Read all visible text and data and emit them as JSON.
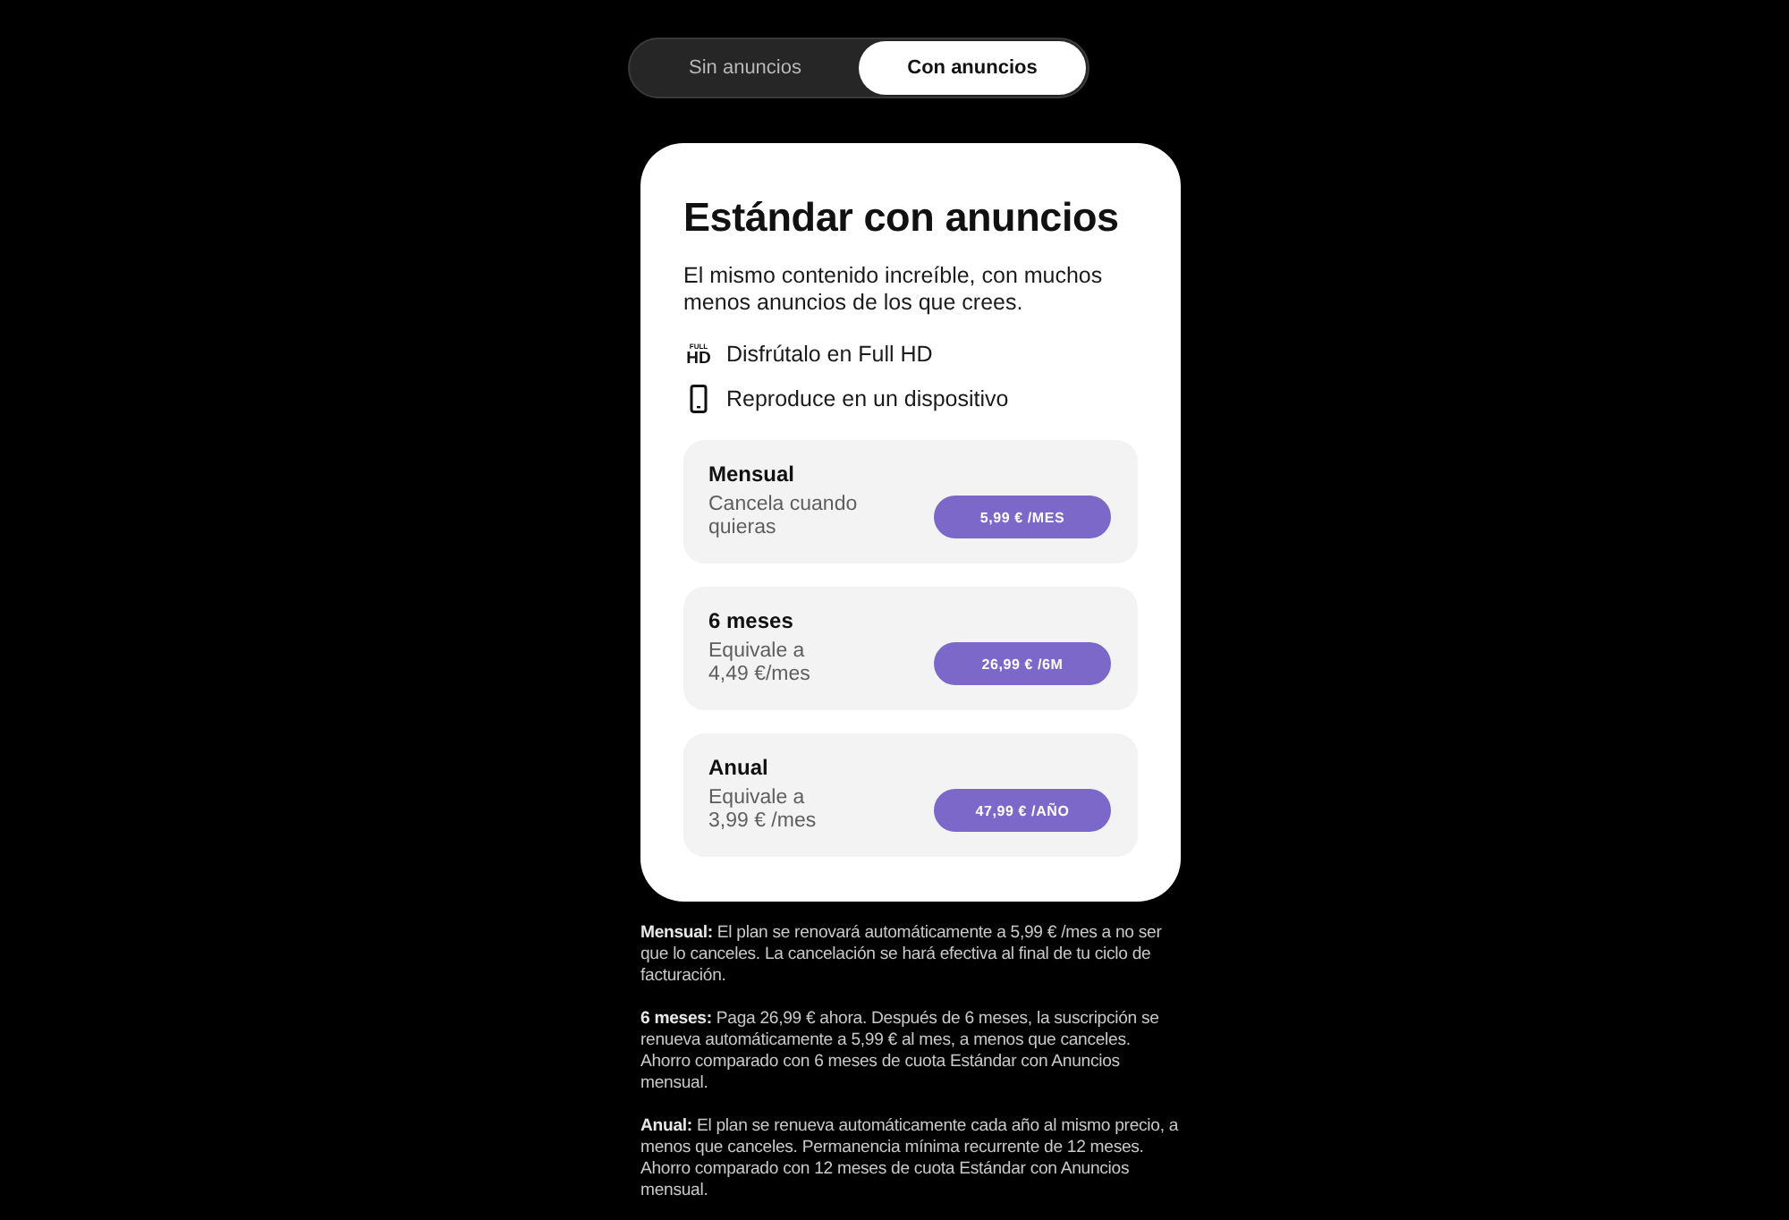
{
  "toggle": {
    "tabs": [
      {
        "label": "Sin anuncios",
        "selected": false
      },
      {
        "label": "Con anuncios",
        "selected": true
      }
    ]
  },
  "plan_card": {
    "title": "Estándar con anuncios",
    "description": "El mismo contenido increíble, con muchos menos anuncios de los que crees.",
    "features": [
      {
        "kind": "resolution",
        "badge": [
          "FULL",
          "HD"
        ],
        "label": "Disfrútalo en Full HD"
      },
      {
        "kind": "device",
        "label": "Reproduce en un dispositivo"
      }
    ],
    "options": [
      {
        "name": "Mensual",
        "note": "Cancela cuando quieras",
        "price": "5,99 € /MES"
      },
      {
        "name": "6 meses",
        "note": "Equivale a",
        "equivalent": "4,49 €/mes",
        "price": "26,99 € /6M"
      },
      {
        "name": "Anual",
        "note": "Equivale a",
        "equivalent": "3,99 € /mes",
        "price": "47,99 € /AÑO"
      }
    ]
  },
  "footnotes": [
    "**Mensual:** El plan se renovará automáticamente a 5,99 € /mes a no ser que lo canceles. La cancelación se hará efectiva al final de tu ciclo de facturación.",
    "**6 meses:** Paga 26,99 € ahora. Después de 6 meses, la suscripción se renueva automáticamente a 5,99 € al mes, a menos que canceles. Ahorro comparado con 6 meses de cuota Estándar con Anuncios mensual.",
    "**Anual:** El plan se renueva automáticamente cada año al mismo precio, a menos que canceles. Permanencia mínima recurrente de 12 meses. Ahorro comparado con 12 meses de cuota Estándar con Anuncios mensual."
  ]
}
